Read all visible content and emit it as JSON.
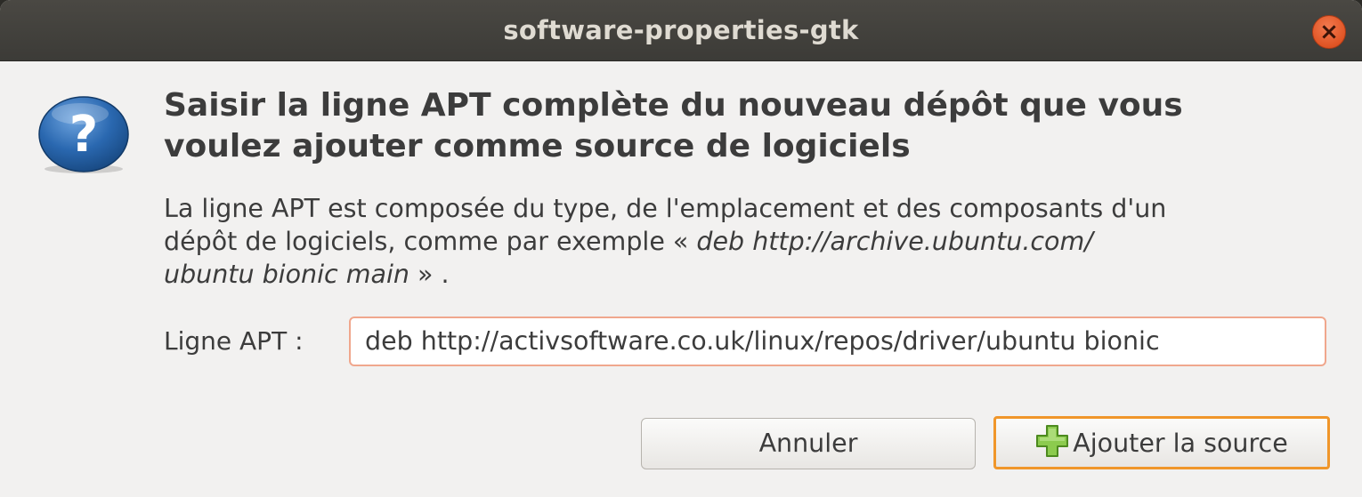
{
  "window": {
    "title": "software-properties-gtk",
    "close_symbol": "×"
  },
  "dialog": {
    "icon": "question-icon",
    "heading_line1": "Saisir la ligne APT complète du nouveau dépôt que vous",
    "heading_line2": "voulez ajouter comme source de logiciels",
    "desc_line1": "La ligne APT est composée du type, de l'emplacement et des composants d'un",
    "desc_line2_text": "dépôt de logiciels, comme par exemple « ",
    "desc_example_line1": "deb http://archive.ubuntu.com/",
    "desc_example_line2": "ubuntu bionic main",
    "desc_end": " » .",
    "apt_label": "Ligne APT :",
    "apt_value": "deb http://activsoftware.co.uk/linux/repos/driver/ubuntu bionic"
  },
  "buttons": {
    "cancel": "Annuler",
    "add": "Ajouter la source",
    "add_icon": "plus-icon"
  },
  "colors": {
    "titlebar": "#3c3b37",
    "close": "#e05424",
    "focus": "#f0962a",
    "background": "#f2f1f0",
    "icon_blue": "#2a68b0",
    "plus_green": "#8ccb4e"
  }
}
